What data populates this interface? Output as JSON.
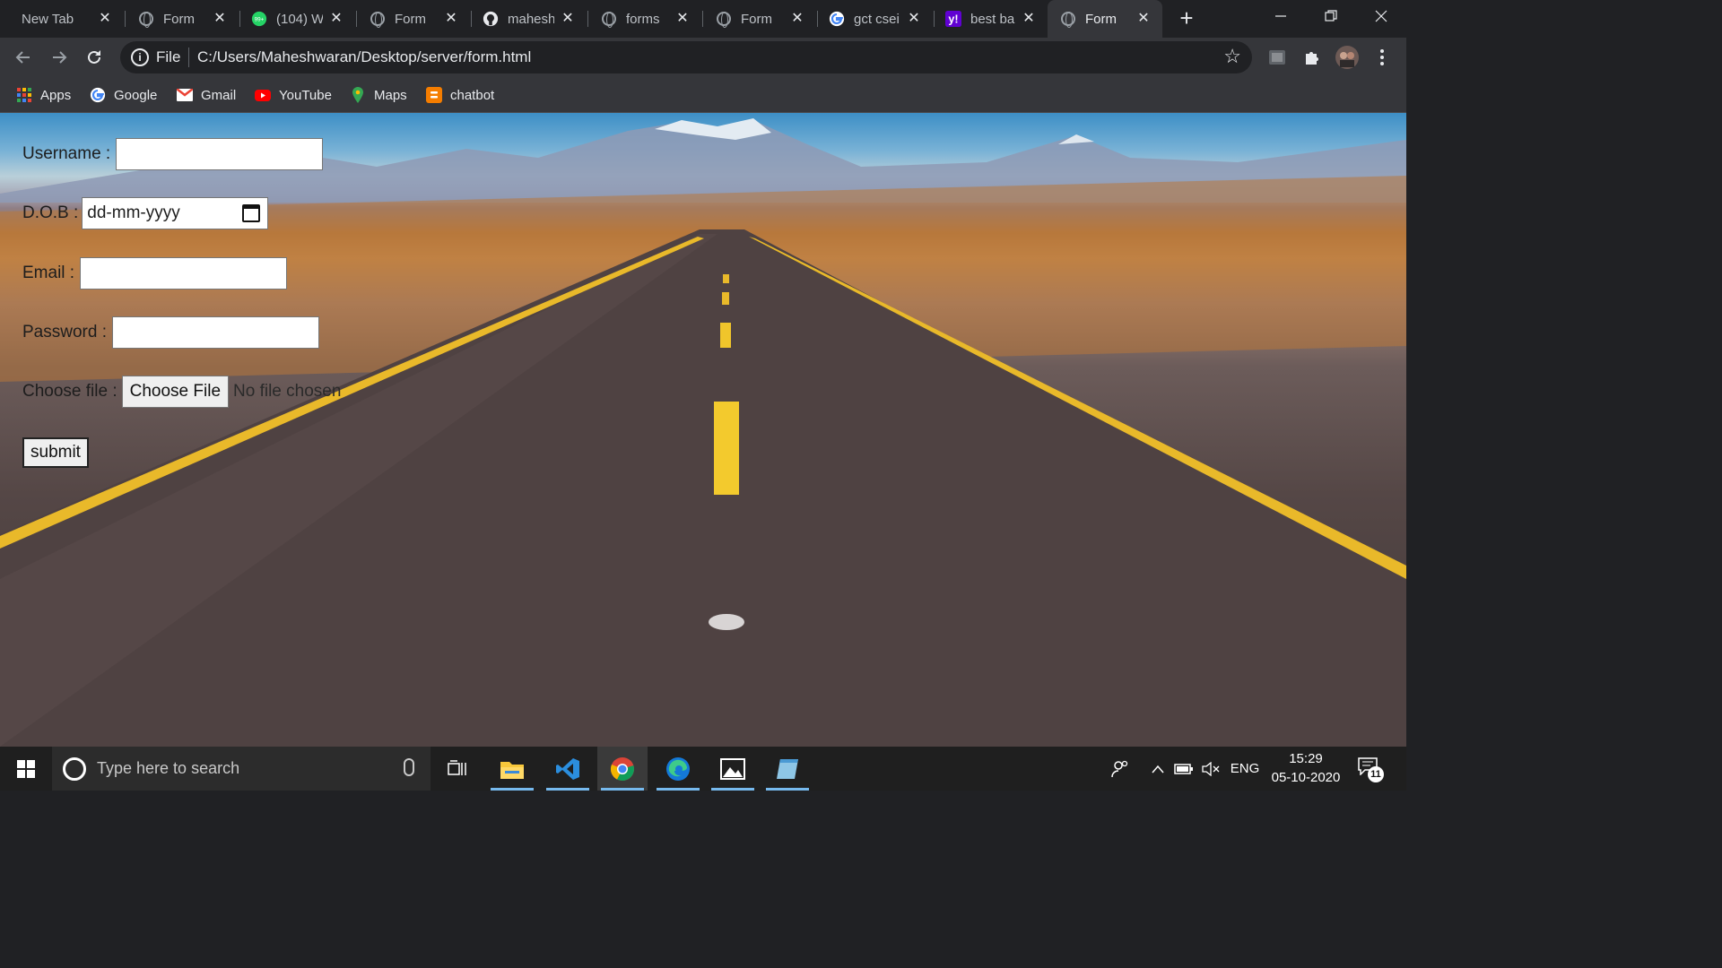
{
  "browser": {
    "tabs": [
      {
        "title": "New Tab",
        "icon": "none"
      },
      {
        "title": "Form",
        "icon": "globe-icon"
      },
      {
        "title": "(104) W",
        "icon": "whatsapp-icon"
      },
      {
        "title": "Form",
        "icon": "globe-icon"
      },
      {
        "title": "mahesh",
        "icon": "github-icon"
      },
      {
        "title": "forms",
        "icon": "globe-icon"
      },
      {
        "title": "Form",
        "icon": "globe-icon"
      },
      {
        "title": "gct csei",
        "icon": "google-icon"
      },
      {
        "title": "best ba",
        "icon": "yahoo-icon"
      },
      {
        "title": "Form",
        "icon": "globe-icon",
        "active": true
      }
    ],
    "whatsapp_badge": "99+",
    "omnibox": {
      "scheme": "File",
      "url": "C:/Users/Maheshwaran/Desktop/server/form.html"
    },
    "bookmarks": [
      {
        "label": "Apps",
        "icon": "apps-grid-icon"
      },
      {
        "label": "Google",
        "icon": "google-icon"
      },
      {
        "label": "Gmail",
        "icon": "gmail-icon"
      },
      {
        "label": "YouTube",
        "icon": "youtube-icon"
      },
      {
        "label": "Maps",
        "icon": "maps-icon"
      },
      {
        "label": "chatbot",
        "icon": "blogger-icon"
      }
    ]
  },
  "form": {
    "username_label": "Username :",
    "dob_label": "D.O.B :",
    "dob_placeholder": "dd-mm-yyyy",
    "email_label": "Email :",
    "password_label": "Password :",
    "file_label": "Choose file :",
    "file_button": "Choose File",
    "file_status": "No file chosen",
    "submit_label": "submit"
  },
  "taskbar": {
    "search_placeholder": "Type here to search",
    "apps": [
      "task-view-icon",
      "file-explorer-icon",
      "vscode-icon",
      "chrome-icon",
      "edge-icon",
      "photos-icon",
      "notepad-app-icon"
    ],
    "language": "ENG",
    "time": "15:29",
    "date": "05-10-2020",
    "notification_count": "11"
  },
  "colors": {
    "chrome_dark": "#202124",
    "chrome_toolbar": "#35363a",
    "taskbar": "#1f1f1f",
    "road_line_yellow": "#e9b92a"
  }
}
